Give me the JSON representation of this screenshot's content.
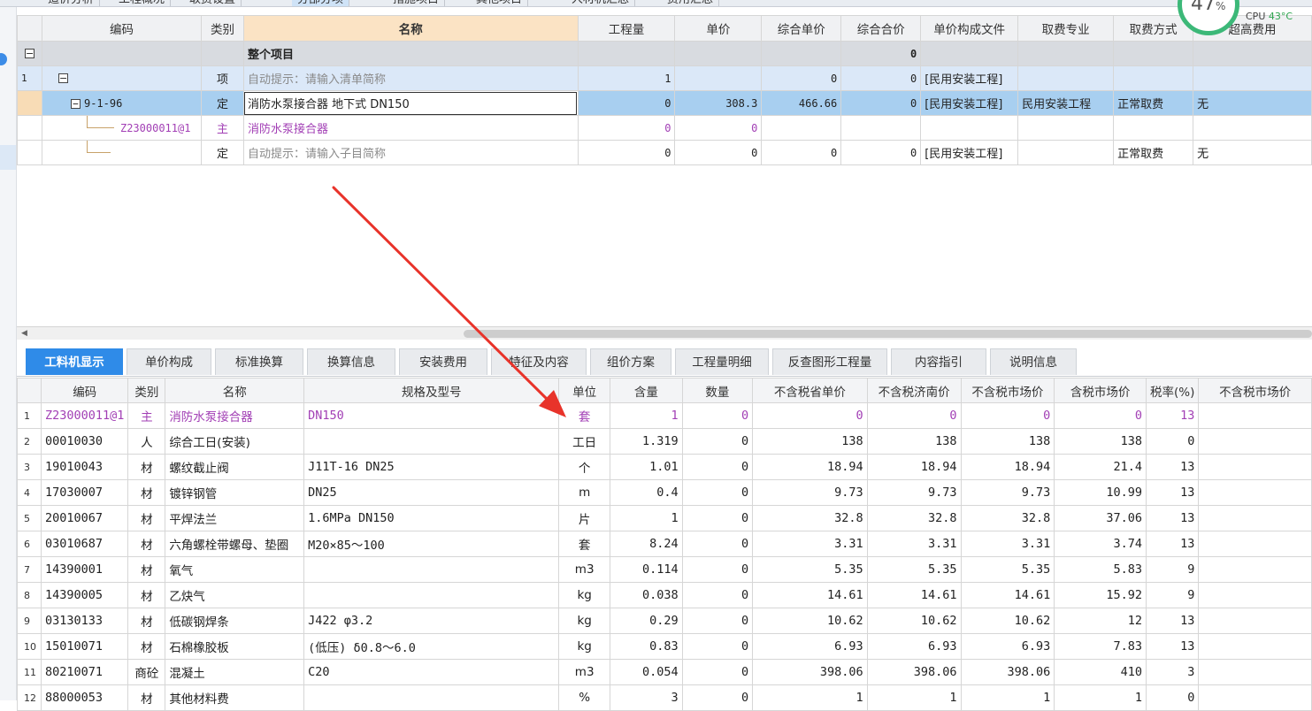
{
  "top_tabs": [
    "造价分析",
    "工程概况",
    "取费设置",
    "分部分项",
    "措施项目",
    "其他项目",
    "人材机汇总",
    "费用汇总"
  ],
  "cpu": {
    "percent": "47",
    "unit": "%",
    "label": "CPU",
    "temp": "43°C"
  },
  "upper": {
    "headers": [
      "编码",
      "类别",
      "名称",
      "工程量",
      "单价",
      "综合单价",
      "综合合价",
      "单价构成文件",
      "取费专业",
      "取费方式",
      "超高费用"
    ],
    "rows": [
      {
        "num": "",
        "code": "",
        "type": "",
        "name": "整个项目",
        "qty": "",
        "price": "",
        "comp_price": "",
        "comp_total": "0",
        "file": "",
        "major": "",
        "method": "",
        "extra": ""
      },
      {
        "num": "1",
        "code": "",
        "type": "项",
        "name": "自动提示：请输入清单简称",
        "qty": "1",
        "price": "",
        "comp_price": "0",
        "comp_total": "0",
        "file": "[民用安装工程]",
        "major": "",
        "method": "",
        "extra": ""
      },
      {
        "num": "",
        "code": "9-1-96",
        "type": "定",
        "name": "消防水泵接合器 地下式 DN150",
        "qty": "0",
        "price": "308.3",
        "comp_price": "466.66",
        "comp_total": "0",
        "file": "[民用安装工程]",
        "major": "民用安装工程",
        "method": "正常取费",
        "extra": "无"
      },
      {
        "num": "",
        "code": "Z23000011@1",
        "type": "主",
        "name": "消防水泵接合器",
        "qty": "0",
        "price": "0",
        "comp_price": "",
        "comp_total": "",
        "file": "",
        "major": "",
        "method": "",
        "extra": ""
      },
      {
        "num": "",
        "code": "",
        "type": "定",
        "name": "自动提示：请输入子目简称",
        "qty": "0",
        "price": "0",
        "comp_price": "0",
        "comp_total": "0",
        "file": "[民用安装工程]",
        "major": "",
        "method": "正常取费",
        "extra": "无"
      }
    ]
  },
  "lower_tabs": [
    "工料机显示",
    "单价构成",
    "标准换算",
    "换算信息",
    "安装费用",
    "特征及内容",
    "组价方案",
    "工程量明细",
    "反查图形工程量",
    "内容指引",
    "说明信息"
  ],
  "lower": {
    "headers": [
      "",
      "编码",
      "类别",
      "名称",
      "规格及型号",
      "单位",
      "含量",
      "数量",
      "不含税省单价",
      "不含税济南价",
      "不含税市场价",
      "含税市场价",
      "税率(%)",
      "不含税市场价"
    ],
    "rows": [
      {
        "num": "1",
        "code": "Z23000011@1",
        "type": "主",
        "name": "消防水泵接合器",
        "spec": "DN150",
        "unit": "套",
        "content": "1",
        "qty": "0",
        "p1": "0",
        "p2": "0",
        "p3": "0",
        "p4": "0",
        "tax": "13"
      },
      {
        "num": "2",
        "code": "00010030",
        "type": "人",
        "name": "综合工日(安装)",
        "spec": "",
        "unit": "工日",
        "content": "1.319",
        "qty": "0",
        "p1": "138",
        "p2": "138",
        "p3": "138",
        "p4": "138",
        "tax": "0"
      },
      {
        "num": "3",
        "code": "19010043",
        "type": "材",
        "name": "螺纹截止阀",
        "spec": "J11T-16 DN25",
        "unit": "个",
        "content": "1.01",
        "qty": "0",
        "p1": "18.94",
        "p2": "18.94",
        "p3": "18.94",
        "p4": "21.4",
        "tax": "13"
      },
      {
        "num": "4",
        "code": "17030007",
        "type": "材",
        "name": "镀锌钢管",
        "spec": "DN25",
        "unit": "m",
        "content": "0.4",
        "qty": "0",
        "p1": "9.73",
        "p2": "9.73",
        "p3": "9.73",
        "p4": "10.99",
        "tax": "13"
      },
      {
        "num": "5",
        "code": "20010067",
        "type": "材",
        "name": "平焊法兰",
        "spec": "1.6MPa DN150",
        "unit": "片",
        "content": "1",
        "qty": "0",
        "p1": "32.8",
        "p2": "32.8",
        "p3": "32.8",
        "p4": "37.06",
        "tax": "13"
      },
      {
        "num": "6",
        "code": "03010687",
        "type": "材",
        "name": "六角螺栓带螺母、垫圈",
        "spec": "M20×85～100",
        "unit": "套",
        "content": "8.24",
        "qty": "0",
        "p1": "3.31",
        "p2": "3.31",
        "p3": "3.31",
        "p4": "3.74",
        "tax": "13"
      },
      {
        "num": "7",
        "code": "14390001",
        "type": "材",
        "name": "氧气",
        "spec": "",
        "unit": "m3",
        "content": "0.114",
        "qty": "0",
        "p1": "5.35",
        "p2": "5.35",
        "p3": "5.35",
        "p4": "5.83",
        "tax": "9"
      },
      {
        "num": "8",
        "code": "14390005",
        "type": "材",
        "name": "乙炔气",
        "spec": "",
        "unit": "kg",
        "content": "0.038",
        "qty": "0",
        "p1": "14.61",
        "p2": "14.61",
        "p3": "14.61",
        "p4": "15.92",
        "tax": "9"
      },
      {
        "num": "9",
        "code": "03130133",
        "type": "材",
        "name": "低碳钢焊条",
        "spec": "J422 φ3.2",
        "unit": "kg",
        "content": "0.29",
        "qty": "0",
        "p1": "10.62",
        "p2": "10.62",
        "p3": "10.62",
        "p4": "12",
        "tax": "13"
      },
      {
        "num": "10",
        "code": "15010071",
        "type": "材",
        "name": "石棉橡胶板",
        "spec": "(低压) δ0.8～6.0",
        "unit": "kg",
        "content": "0.83",
        "qty": "0",
        "p1": "6.93",
        "p2": "6.93",
        "p3": "6.93",
        "p4": "7.83",
        "tax": "13"
      },
      {
        "num": "11",
        "code": "80210071",
        "type": "商砼",
        "name": "混凝土",
        "spec": "C20",
        "unit": "m3",
        "content": "0.054",
        "qty": "0",
        "p1": "398.06",
        "p2": "398.06",
        "p3": "398.06",
        "p4": "410",
        "tax": "3"
      },
      {
        "num": "12",
        "code": "88000053",
        "type": "材",
        "name": "其他材料费",
        "spec": "",
        "unit": "%",
        "content": "3",
        "qty": "0",
        "p1": "1",
        "p2": "1",
        "p3": "1",
        "p4": "1",
        "tax": "0"
      }
    ]
  },
  "annotation_color": "#e8332a"
}
